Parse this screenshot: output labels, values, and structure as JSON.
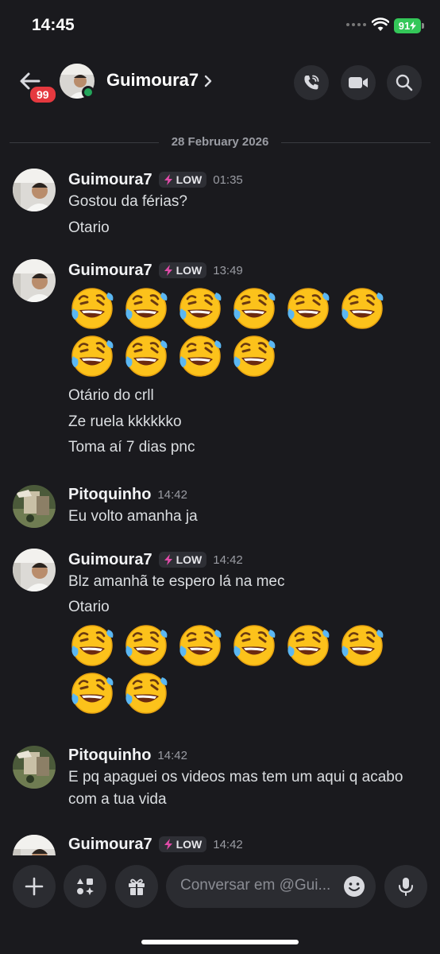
{
  "status_bar": {
    "time": "14:45",
    "battery": "91"
  },
  "header": {
    "badge": "99",
    "name": "Guimoura7"
  },
  "date_divider": "28 February 2026",
  "messages": [
    {
      "author": "Guimoura7",
      "tag": "LOW",
      "time": "01:35",
      "lines": [
        "Gostou da férias?",
        "Otario"
      ]
    },
    {
      "author": "Guimoura7",
      "tag": "LOW",
      "time": "13:49",
      "emoji_rows": [
        6,
        4
      ],
      "lines": [
        "Otário do crll",
        "Ze ruela kkkkkko",
        "Toma aí 7 dias pnc"
      ]
    },
    {
      "author": "Pitoquinho",
      "time": "14:42",
      "lines": [
        "Eu volto amanha ja"
      ]
    },
    {
      "author": "Guimoura7",
      "tag": "LOW",
      "time": "14:42",
      "lines": [
        "Blz amanhã te espero lá na mec",
        "Otario"
      ],
      "emoji_rows": [
        6,
        2
      ]
    },
    {
      "author": "Pitoquinho",
      "time": "14:42",
      "lines": [
        "E pq apaguei os videos mas tem um aqui q acabo com a tua vida"
      ]
    },
    {
      "author": "Guimoura7",
      "tag": "LOW",
      "time": "14:42"
    }
  ],
  "composer": {
    "placeholder": "Conversar em @Gui..."
  },
  "emoji_icon": "rolling-on-floor-laughing-icon"
}
